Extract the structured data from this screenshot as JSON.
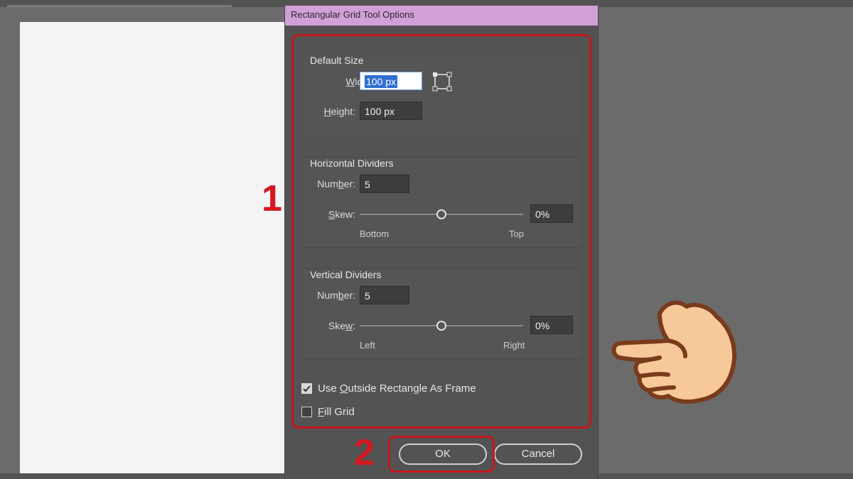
{
  "dialog": {
    "title": "Rectangular Grid Tool Options",
    "default_size": {
      "title": "Default Size",
      "width_label_pre": "",
      "width_label_u": "W",
      "width_label_post": "idth:",
      "width_value": "100 px",
      "height_label_u": "H",
      "height_label_post": "eight:",
      "height_value": "100 px"
    },
    "horizontal": {
      "title": "Horizontal Dividers",
      "number_label_pre": "Num",
      "number_label_u": "b",
      "number_label_post": "er:",
      "number_value": "5",
      "skew_label_u": "S",
      "skew_label_post": "kew:",
      "skew_value": "0%",
      "skew_level_percent": 0,
      "left_tick": "Bottom",
      "right_tick": "Top"
    },
    "vertical": {
      "title": "Vertical Dividers",
      "number_label_pre": "Num",
      "number_label_u": "b",
      "number_label_post": "er:",
      "number_value": "5",
      "skew_label_pre": "Ske",
      "skew_label_u": "w",
      "skew_label_post": ":",
      "skew_value": "0%",
      "skew_level_percent": 0,
      "left_tick": "Left",
      "right_tick": "Right"
    },
    "use_outside": {
      "label_pre": "Use ",
      "label_u": "O",
      "label_post": "utside Rectangle As Frame",
      "checked": true
    },
    "fill_grid": {
      "label_u": "F",
      "label_post": "ill Grid",
      "checked": false
    },
    "ok_label": "OK",
    "cancel_label": "Cancel"
  },
  "annotations": {
    "step1": "1",
    "step2": "2",
    "highlight_color": "#c4161c",
    "hand_icon": "pointing-hand-icon"
  }
}
